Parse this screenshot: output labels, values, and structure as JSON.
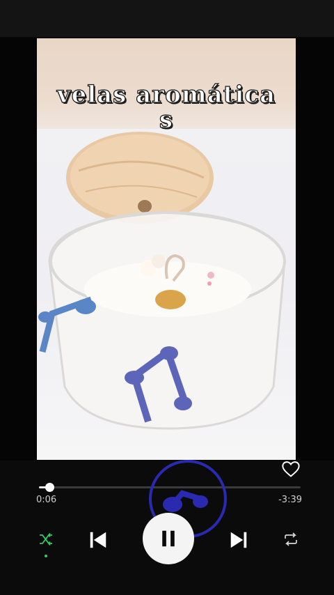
{
  "video": {
    "title_text": "velas aromáticas",
    "description": "aromatic candle in glass jar with wooden lid"
  },
  "player": {
    "elapsed": "0:06",
    "remaining": "-3:39",
    "progress": 0.04,
    "shuffle_active": true,
    "playing": true
  },
  "colors": {
    "accent_green": "#2bd06a",
    "note_blue": "#5a86c8",
    "note_indigo": "#5d65b9",
    "overlay_blue": "#2a2ab0"
  }
}
